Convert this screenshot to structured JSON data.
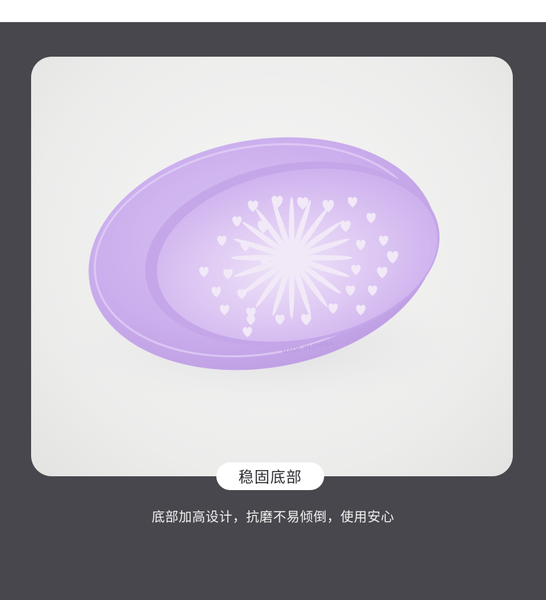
{
  "photo": {
    "subject": "soap-dish",
    "embossed_text": "MADE IN CHINA",
    "dish_color": "#c9aaeb",
    "rim_color": "#d8c0f2",
    "hole_color": "#f1e9f7"
  },
  "feature": {
    "title": "稳固底部",
    "description": "底部加高设计，抗磨不易倾倒，使用安心"
  },
  "colors": {
    "page_background": "#48474d",
    "card_background": "#eeeeed",
    "pill_background": "#ffffff",
    "title_text": "#2e2d32",
    "description_text": "#f2f2f2"
  }
}
